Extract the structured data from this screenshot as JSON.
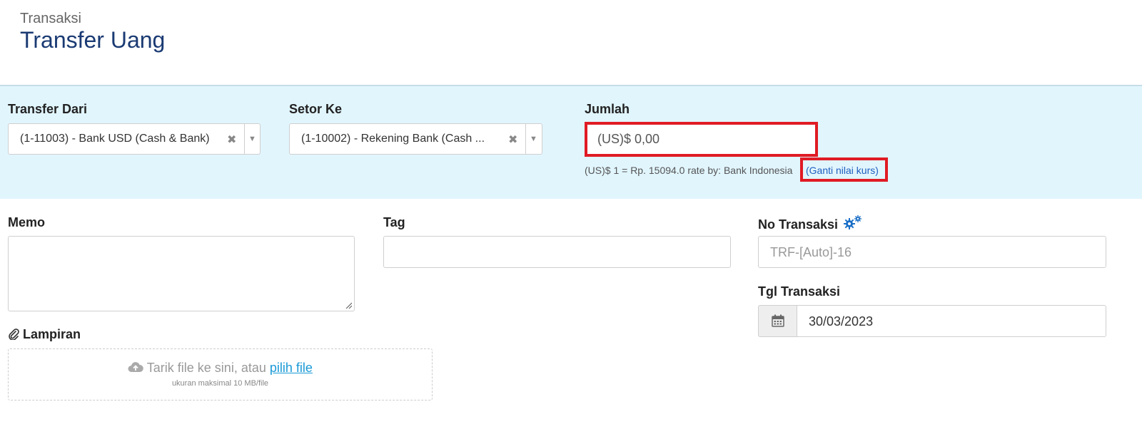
{
  "header": {
    "subtitle": "Transaksi",
    "title": "Transfer Uang"
  },
  "transfer_from": {
    "label": "Transfer Dari",
    "value": "(1-11003) - Bank USD (Cash & Bank)"
  },
  "deposit_to": {
    "label": "Setor Ke",
    "value": "(1-10002) - Rekening Bank (Cash ..."
  },
  "amount": {
    "label": "Jumlah",
    "value": "(US)$ 0,00",
    "rate_text": "(US)$ 1 = Rp. 15094.0 rate by: Bank Indonesia",
    "rate_link": "(Ganti nilai kurs)"
  },
  "memo": {
    "label": "Memo"
  },
  "tag": {
    "label": "Tag"
  },
  "transaction_no": {
    "label": "No Transaksi",
    "placeholder": "TRF-[Auto]-16"
  },
  "transaction_date": {
    "label": "Tgl Transaksi",
    "value": "30/03/2023"
  },
  "attachment": {
    "label": "Lampiran",
    "drop_text": "Tarik file ke sini, atau ",
    "pick_link": "pilih file",
    "max_size": "ukuran maksimal 10 MB/file"
  },
  "colors": {
    "title": "#1a3a73",
    "band": "#e1f5fd",
    "highlight": "#e01b24",
    "link": "#1a9ad6"
  }
}
